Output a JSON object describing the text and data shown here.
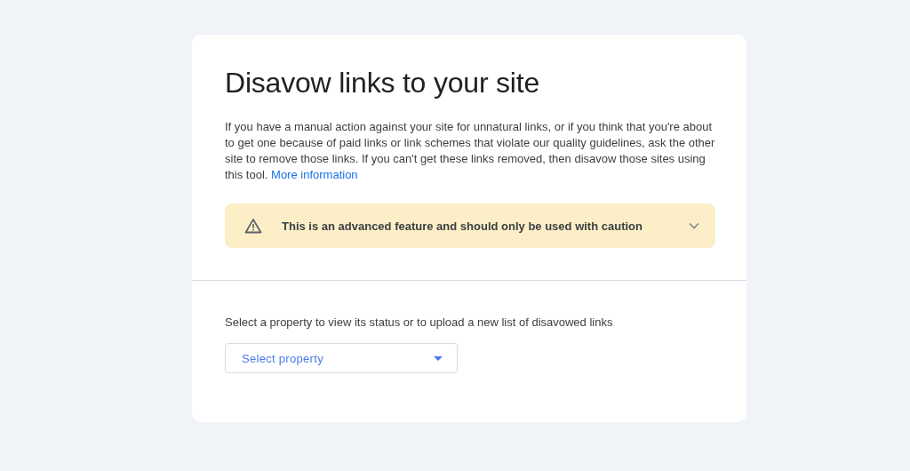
{
  "title": "Disavow links to your site",
  "intro": {
    "text": "If you have a manual action against your site for unnatural links, or if you think that you're about to get one because of paid links or link schemes that violate our quality guidelines, ask the other site to remove those links. If you can't get these links removed, then disavow those sites using this tool.",
    "link": "More information"
  },
  "warning": {
    "text": "This is an advanced feature and should only be used with caution",
    "expanded": false
  },
  "property": {
    "prompt": "Select a property to view its status or to upload a new list of disavowed links",
    "placeholder": "Select property"
  }
}
